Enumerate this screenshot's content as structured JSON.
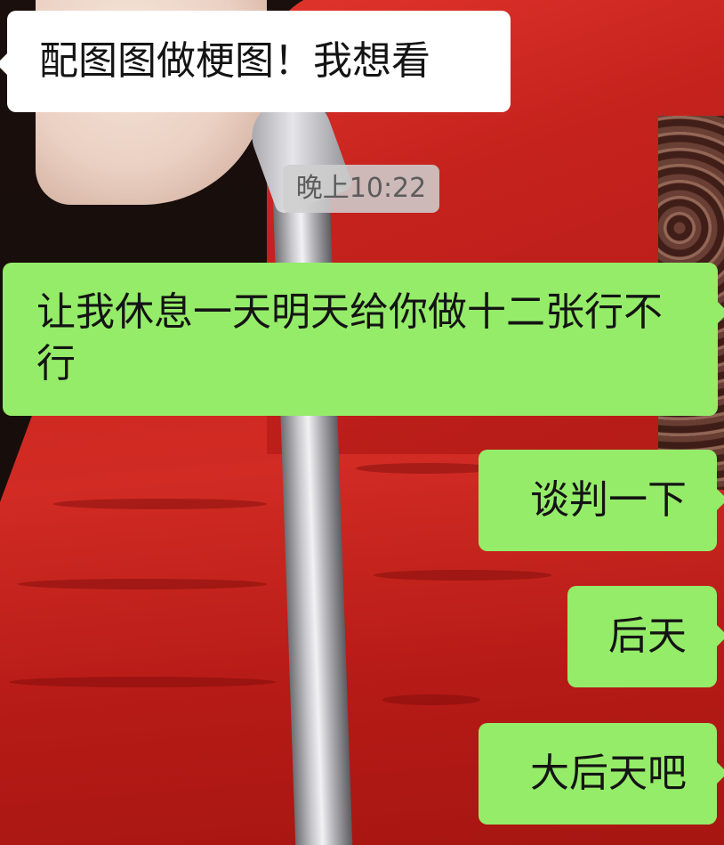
{
  "messages": [
    {
      "direction": "incoming",
      "text": "配图图做梗图！我想看"
    },
    {
      "direction": "outgoing",
      "text": "让我休息一天明天给你做十二张行不行"
    },
    {
      "direction": "outgoing",
      "text": "谈判一下"
    },
    {
      "direction": "outgoing",
      "text": "后天"
    },
    {
      "direction": "outgoing",
      "text": "大后天吧"
    }
  ],
  "timestamp": "晚上10:22",
  "colors": {
    "incoming_bubble": "#ffffff",
    "outgoing_bubble": "#95ec69",
    "timestamp_bg": "#cecece",
    "text": "#141414"
  }
}
